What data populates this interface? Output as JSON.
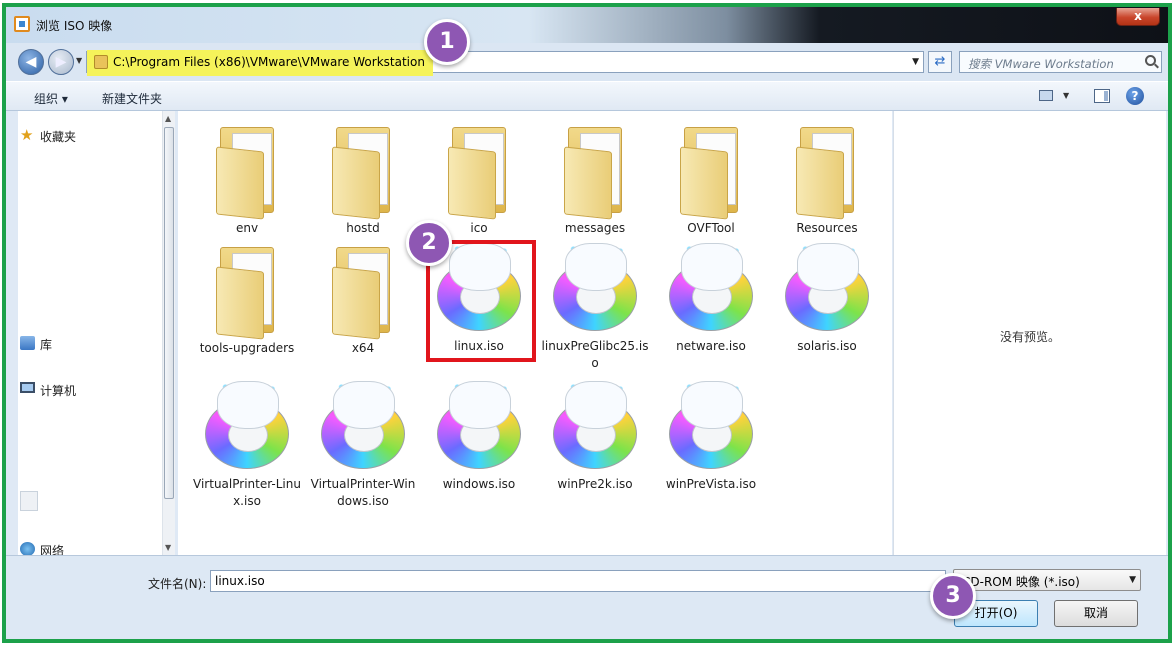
{
  "window": {
    "title": "浏览 ISO 映像",
    "close_label": "x"
  },
  "address": {
    "path": "C:\\Program Files (x86)\\VMware\\VMware Workstation",
    "search_placeholder": "搜索 VMware Workstation"
  },
  "toolbar": {
    "organize_label": "组织 ▾",
    "new_folder_label": "新建文件夹",
    "help_label": "?"
  },
  "sidebar": {
    "items": [
      {
        "label": "收藏夹",
        "icon": "star-icon"
      },
      {
        "label": "库",
        "icon": "library-icon"
      },
      {
        "label": "计算机",
        "icon": "computer-icon"
      },
      {
        "label": "网络",
        "icon": "network-icon"
      }
    ]
  },
  "files": {
    "row1": [
      "env",
      "hostd",
      "ico",
      "messages",
      "OVFTool",
      "Resources"
    ],
    "row2": [
      "tools-upgraders",
      "x64",
      "linux.iso",
      "linuxPreGlibc25.iso",
      "netware.iso",
      "solaris.iso"
    ],
    "row3": [
      "VirtualPrinter-Linux.iso",
      "VirtualPrinter-Windows.iso",
      "windows.iso",
      "winPre2k.iso",
      "winPreVista.iso"
    ]
  },
  "preview": {
    "empty_text": "没有预览。"
  },
  "footer": {
    "filename_label": "文件名(N):",
    "filename_value": "linux.iso",
    "filter_value": "CD-ROM 映像 (*.iso)",
    "open_label": "打开(O)",
    "cancel_label": "取消"
  },
  "callouts": [
    "1",
    "2",
    "3"
  ],
  "colors": {
    "frame": "#1ca14a",
    "highlight_box": "#e1151c",
    "callout": "#8e57b3",
    "address_highlight": "#f5f35a"
  }
}
